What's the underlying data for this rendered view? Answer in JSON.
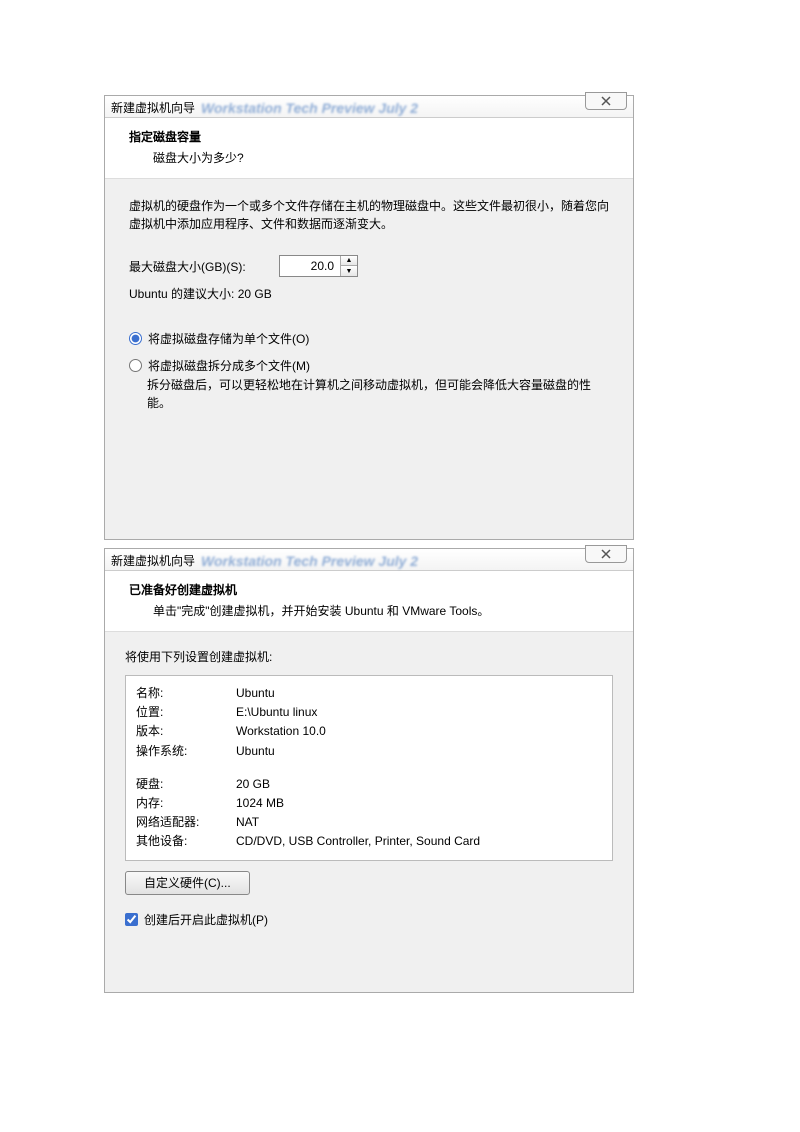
{
  "dialog1": {
    "window_title": "新建虚拟机向导",
    "blur_text": "Workstation Tech Preview July 2",
    "header_title": "指定磁盘容量",
    "header_sub": "磁盘大小为多少?",
    "desc": "虚拟机的硬盘作为一个或多个文件存储在主机的物理磁盘中。这些文件最初很小，随着您向虚拟机中添加应用程序、文件和数据而逐渐变大。",
    "max_size_label": "最大磁盘大小(GB)(S):",
    "max_size_value": "20.0",
    "recommend": "Ubuntu 的建议大小: 20 GB",
    "radio_single": "将虚拟磁盘存储为单个文件(O)",
    "radio_split": "将虚拟磁盘拆分成多个文件(M)",
    "split_help": "拆分磁盘后，可以更轻松地在计算机之间移动虚拟机，但可能会降低大容量磁盘的性能。"
  },
  "dialog2": {
    "window_title": "新建虚拟机向导",
    "blur_text": "Workstation Tech Preview July 2",
    "header_title": "已准备好创建虚拟机",
    "header_sub": "单击\"完成\"创建虚拟机，并开始安装 Ubuntu 和 VMware Tools。",
    "summary_intro": "将使用下列设置创建虚拟机:",
    "rows": {
      "name_k": "名称:",
      "name_v": "Ubuntu",
      "loc_k": "位置:",
      "loc_v": "E:\\Ubuntu linux",
      "ver_k": "版本:",
      "ver_v": "Workstation 10.0",
      "os_k": "操作系统:",
      "os_v": "Ubuntu",
      "disk_k": "硬盘:",
      "disk_v": "20 GB",
      "mem_k": "内存:",
      "mem_v": "1024 MB",
      "net_k": "网络适配器:",
      "net_v": "NAT",
      "other_k": "其他设备:",
      "other_v": "CD/DVD, USB Controller, Printer, Sound Card"
    },
    "customize_btn": "自定义硬件(C)...",
    "poweron_check": "创建后开启此虚拟机(P)"
  }
}
